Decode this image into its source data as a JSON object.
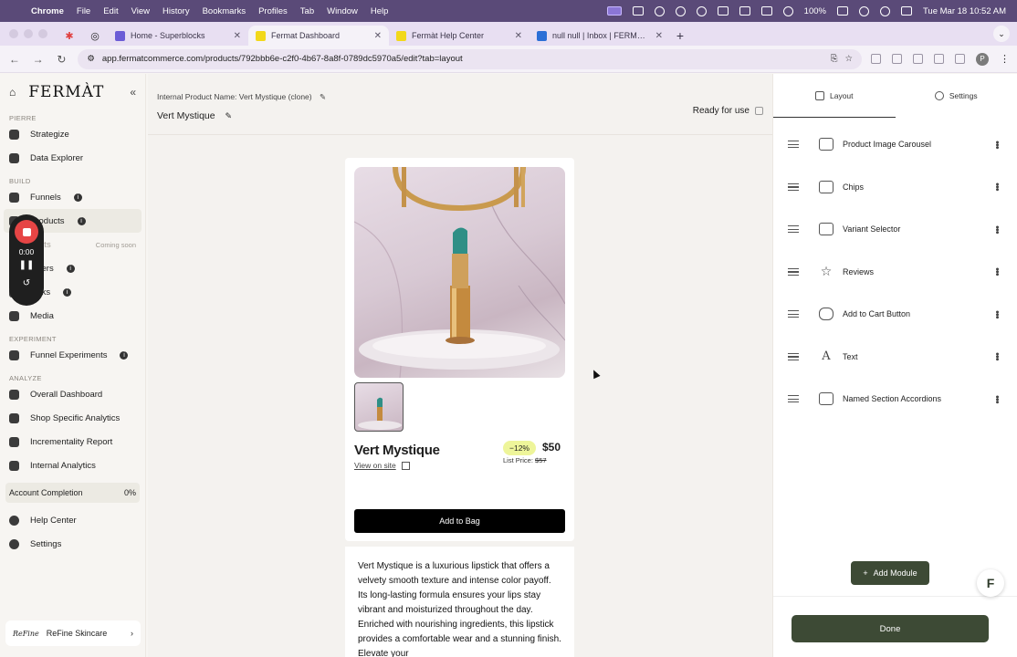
{
  "menubar": {
    "app": "Chrome",
    "items": [
      "File",
      "Edit",
      "View",
      "History",
      "Bookmarks",
      "Profiles",
      "Tab",
      "Window",
      "Help"
    ],
    "battery": "100%",
    "clock": "Tue Mar 18  10:52 AM"
  },
  "tabs": [
    {
      "label": "Home - Superblocks",
      "color": "#6b5cd6"
    },
    {
      "label": "Fermat Dashboard",
      "color": "#f2d81a"
    },
    {
      "label": "Fermàt Help Center",
      "color": "#f2d81a"
    },
    {
      "label": "null null | Inbox | FERMÀT | In",
      "color": "#2b6fd6"
    }
  ],
  "address": {
    "url": "app.fermatcommerce.com/products/792bbb6e-c2f0-4b67-8a8f-0789dc5970a5/edit?tab=layout",
    "profile": "P"
  },
  "sidebar": {
    "logo": "FERMÀT",
    "sections": {
      "pierre": "PIERRE",
      "build": "BUILD",
      "experiment": "EXPERIMENT",
      "analyze": "ANALYZE"
    },
    "pierre_items": [
      "Strategize",
      "Data Explorer"
    ],
    "build_items": {
      "funnels": "Funnels",
      "products": "Products",
      "carts": "Carts",
      "coming_soon": "Coming soon",
      "offers": "Offers",
      "links": "Links",
      "media": "Media"
    },
    "experiment_items": [
      "Funnel Experiments"
    ],
    "analyze_items": [
      "Overall Dashboard",
      "Shop Specific Analytics",
      "Incrementality Report",
      "Internal Analytics"
    ],
    "account_completion": {
      "label": "Account Completion",
      "value": "0%"
    },
    "footer_items": [
      "Help Center",
      "Settings"
    ],
    "brand": {
      "logo": "ReFine",
      "name": "ReFine Skincare"
    }
  },
  "recorder": {
    "time": "0:00"
  },
  "main": {
    "internal_name": "Internal Product Name: Vert Mystique (clone)",
    "product_name": "Vert Mystique",
    "ready_label": "Ready for use"
  },
  "preview": {
    "title": "Vert Mystique",
    "view_on_site": "View on site",
    "discount": "−12%",
    "price": "$50",
    "list_price_label": "List Price:",
    "list_price": "$57",
    "add_to_bag": "Add to Bag",
    "description": "Vert Mystique is a luxurious lipstick that offers a velvety smooth texture and intense color payoff. Its long-lasting formula ensures your lips stay vibrant and moisturized throughout the day. Enriched with nourishing ingredients, this lipstick provides a comfortable wear and a stunning finish. Elevate your"
  },
  "panel": {
    "tabs": [
      "Layout",
      "Settings"
    ],
    "modules": [
      {
        "label": "Product Image Carousel",
        "icon": "carousel-icon"
      },
      {
        "label": "Chips",
        "icon": "chips-icon"
      },
      {
        "label": "Variant Selector",
        "icon": "variant-icon"
      },
      {
        "label": "Reviews",
        "icon": "star-icon"
      },
      {
        "label": "Add to Cart Button",
        "icon": "cart-button-icon"
      },
      {
        "label": "Text",
        "icon": "text-icon"
      },
      {
        "label": "Named Section Accordions",
        "icon": "accordion-icon"
      }
    ],
    "add_module": "Add Module",
    "done": "Done"
  },
  "colors": {
    "accent": "#3d4a35",
    "discount_bg": "#eef59a",
    "menubar": "#5a4a78"
  }
}
